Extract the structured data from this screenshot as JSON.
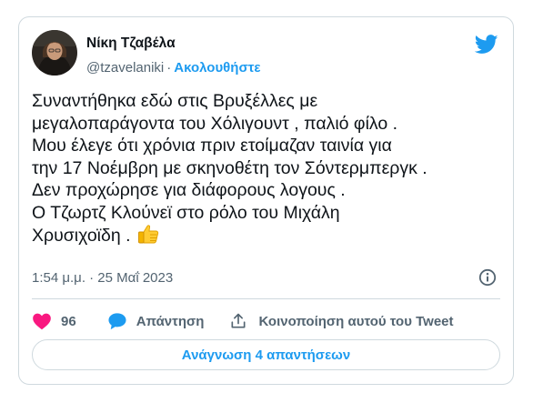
{
  "tweet": {
    "author_name": "Νίκη Τζαβέλα",
    "handle": "@tzavelaniki",
    "separator": "·",
    "follow_label": "Ακολουθήστε",
    "text_lines": [
      "Συναντήθηκα εδώ στις Βρυξέλλες με",
      "μεγαλοπαράγοντα του Χόλιγουντ , παλιό φίλο .",
      "Μου έλεγε ότι χρόνια πριν ετοίμαζαν ταινία για",
      "την 17 Νοέμβρη με σκηνοθέτη τον Σόντερμπεργκ .",
      "Δεν προχώρησε για διάφορους λογους .",
      "Ο Τζωρτζ Κλούνεϊ στο ρόλο του Μιχάλη",
      "Χρυσιχοϊδη . "
    ],
    "emoji_icon": "thumbs-up-emoji",
    "timestamp": "1:54 μ.μ. · 25 Μαΐ 2023",
    "like_count": "96",
    "reply_label": "Απάντηση",
    "share_label": "Κοινοποίηση αυτού του Tweet",
    "read_replies_label": "Ανάγνωση 4 απαντήσεων"
  },
  "colors": {
    "accent": "#1d9bf0",
    "like": "#f91880",
    "muted": "#536471",
    "text": "#0f1419",
    "border": "#cfd9de"
  },
  "icons": {
    "brand": "twitter-bird-icon",
    "info": "info-icon",
    "like": "heart-icon",
    "reply": "speech-bubble-icon",
    "share": "share-upload-icon"
  }
}
